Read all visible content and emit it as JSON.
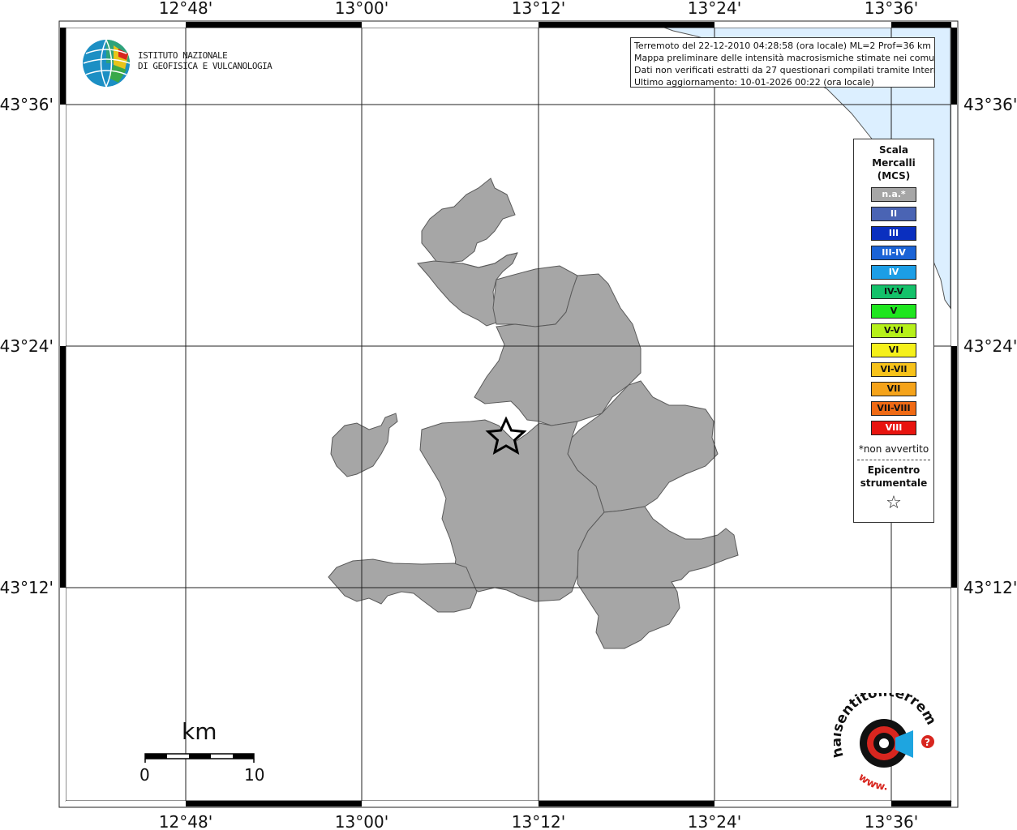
{
  "map": {
    "top_labels": [
      "12°48'",
      "13°00'",
      "13°12'",
      "13°24'",
      "13°36'"
    ],
    "bottom_labels": [
      "12°48'",
      "13°00'",
      "13°12'",
      "13°24'",
      "13°36'"
    ],
    "left_labels": [
      "43°36'",
      "43°24'",
      "43°12'"
    ],
    "right_labels": [
      "43°36'",
      "43°24'",
      "43°12'"
    ],
    "region_color": "#a6a6a6",
    "sea_color": "#dcefff"
  },
  "info": {
    "line1": "Terremoto del 22-12-2010 04:28:58 (ora locale) ML=2 Prof=36 km",
    "line2": "Mappa preliminare delle intensità macrosismiche stimate nei comuni",
    "line3": "Dati non verificati estratti da 27 questionari compilati tramite Internet.",
    "line4": "Ultimo aggiornamento: 10-01-2026 00:22 (ora locale)"
  },
  "logo": {
    "line1": "ISTITUTO NAZIONALE",
    "line2": "DI GEOFISICA E VULCANOLOGIA"
  },
  "legend": {
    "title1": "Scala",
    "title2": "Mercalli",
    "title3": "(MCS)",
    "items": [
      {
        "label": "n.a.*",
        "color": "#a6a6a6",
        "text_color": "#ffffff"
      },
      {
        "label": "II",
        "color": "#4a64b4",
        "text_color": "#ffffff"
      },
      {
        "label": "III",
        "color": "#0a2fbf",
        "text_color": "#ffffff"
      },
      {
        "label": "III-IV",
        "color": "#1a63d6",
        "text_color": "#ffffff"
      },
      {
        "label": "IV",
        "color": "#1c9ee6",
        "text_color": "#ffffff"
      },
      {
        "label": "IV-V",
        "color": "#14c16a",
        "text_color": "#111111"
      },
      {
        "label": "V",
        "color": "#1fe61f",
        "text_color": "#111111"
      },
      {
        "label": "V-VI",
        "color": "#b6f01a",
        "text_color": "#111111"
      },
      {
        "label": "VI",
        "color": "#f5f01a",
        "text_color": "#111111"
      },
      {
        "label": "VI-VII",
        "color": "#f7c21a",
        "text_color": "#111111"
      },
      {
        "label": "VII",
        "color": "#f5a31a",
        "text_color": "#111111"
      },
      {
        "label": "VII-VIII",
        "color": "#f06a14",
        "text_color": "#111111"
      },
      {
        "label": "VIII",
        "color": "#e8140f",
        "text_color": "#ffffff"
      }
    ],
    "note": "*non avvertito",
    "epi1": "Epicentro",
    "epi2": "strumentale",
    "star": "☆"
  },
  "scale": {
    "unit": "km",
    "min": "0",
    "max": "10"
  },
  "hai_logo": {
    "text": "haisentitoilterremoto.it",
    "www": "www."
  }
}
